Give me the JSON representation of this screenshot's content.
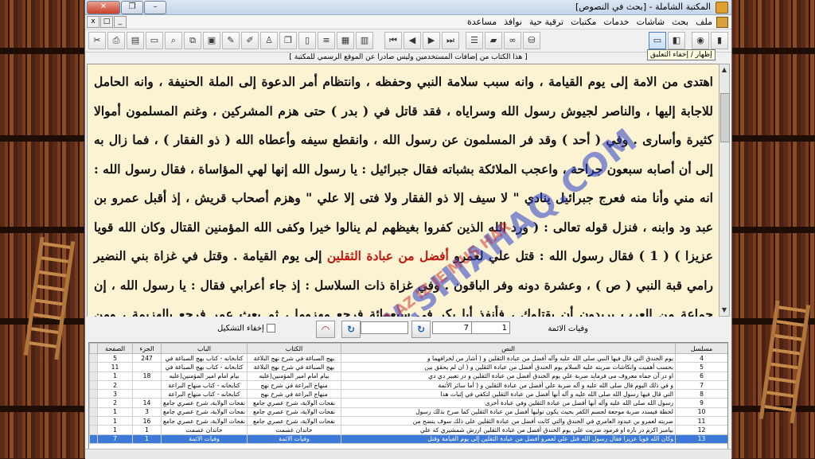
{
  "window": {
    "title": "المكتبة الشاملة - [بحث في النصوص]",
    "buttons": {
      "minimize": "–",
      "restore": "❐",
      "close": "✕"
    }
  },
  "menu": {
    "items": [
      "ملف",
      "بحث",
      "شاشات",
      "خدمات",
      "مكتبات",
      "ترقية حية",
      "نوافذ",
      "مساعدة"
    ],
    "mdi_buttons": {
      "close": "x",
      "restore": "□",
      "minimize": "_"
    }
  },
  "toolbar": {
    "tooltip": "إظهار / إخفاء التعليق"
  },
  "notice": "[ هذا الكتاب من إضافات المستخدمين وليس صادرا عن الموقع الرسمي للمكتبة ]",
  "reader": {
    "before_highlight": "اهتدى من الامة إلى يوم القيامة ، وانه سبب سلامة النبي وحفظه ، وانتظام أمر الدعوة إلى الملة الحنيفة ، وانه الحامل للاجابة إليها ، والناصر لجيوش رسول الله وسراياه ، فقد قاتل في ( بدر ) حتى هزم المشركين ، وغنم المسلمون أموالا كثيرة وأسارى . وفي ( أحد ) وقد فر المسلمون عن رسول الله ، وانقطع سيفه وأعطاه الله ( ذو الفقار ) ، فما زال به إلى أن أصابه سبعون جراحة ، واعجب الملائكة بشباته فقال جبرائيل : يا رسول الله إنها لهي المؤاساة ، فقال رسول الله : انه مني وأنا منه فعرج جبرائيل ينادي \" لا سيف إلا ذو الفقار ولا فتى إلا علي \" وهزم أصحاب قريش ، إذ أقبل عمرو بن عبد ود وابنه ، فنزل قوله تعالى : ( ورد الله الذين كفروا بغيظهم لم ينالوا خيرا وكفى الله المؤمنين القتال وكان الله قويا عزيزا ) ( 1 ) فقال رسول الله : قتل علي لعمرو ",
    "highlight": "أفضل من عبادة الثقلين",
    "after_highlight": " إلى يوم القيامة . وقتل في غزاة بني النضير رامي قبة النبي ( ص ) ، وعشرة دونه وفر الباقون . وفي غزاة ذات السلاسل : إذ جاء أعرابي فقال : يا رسول الله ، إن جماعة من العرب يريدون أن يقتلوك ، فأنفذ أبا بكر في سبعمائة فرجع مهزوما ، ثم بعث عمر فرجع بالهزيمة ، ومن أصحابه مهزومين ، فقال رسول الله : في الثالثة أين"
  },
  "watermark": {
    "main": "WWW.SHIAHAQ.COM",
    "sub": "FAR AZ IZ JE MUS HAR"
  },
  "nav": {
    "label": "وفيات الائمة",
    "field_1": "1",
    "field_2": "7",
    "refresh_glyph": "↻",
    "hide_format_label": "إخفاء التشكيل"
  },
  "grid": {
    "headers": {
      "serial": "مسلسل",
      "text": "النص",
      "book": "الكتاب",
      "chapter": "الباب",
      "part": "الجزء",
      "page": "الصفحة"
    },
    "rows": [
      {
        "serial": "4",
        "text": "يوم الخندق التي قال فيها النبي صلى الله عليه وآله أفضل من عبادة الثقلين و ( أشار من لخرافهما و",
        "book": "بهج الصباغة في شرح نهج البلاغة",
        "chapter": "كتابخانه - كتاب بهج الصباغة في",
        "part": "247",
        "page": "5"
      },
      {
        "serial": "5",
        "text": "بحسب أهميت وانكاشات ضربته عليه السلام يوم الخندق أفضل من عبادة الثقلين و ( ان لم يحقق بين",
        "book": "بهج الصباغة في شرح نهج البلاغة",
        "chapter": "كتابخانه - كتاب بهج الصباغة في",
        "part": "",
        "page": "11"
      },
      {
        "serial": "6",
        "text": "او در آن جماه معروف می فرمايد ضربة علي يوم الخندق أفضل من عبادة الثقلين و در تعبير دي دي",
        "book": "بيام امام امير المؤمنين(عليه",
        "chapter": "بيام امام امير المؤمنين(عليه",
        "part": "18",
        "page": "1"
      },
      {
        "serial": "7",
        "text": "و في ذلك اليوم قال صلى الله عليه و آله ضربة علي أفضل من عبادة الثقلين و ( أما سائر الأئمة",
        "book": "منهاج البراعة في شرح نهج",
        "chapter": "كتابخانه - كتاب منهاج البراعة",
        "part": "",
        "page": "2"
      },
      {
        "serial": "8",
        "text": "التي قال فيها رسول الله صلى الله عليه و آله أنها أفضل من عبادة الثقلين لتكفي في إثبات هذا",
        "book": "منهاج البراعة في شرح نهج",
        "chapter": "كتابخانه - كتاب منهاج البراعة",
        "part": "",
        "page": "3"
      },
      {
        "serial": "9",
        "text": "رسول الله صلى الله عليه وآله أنها أفضل من عبادة الثقلين وفي عبادة أخرى",
        "book": "نفحات الولاية، شرح عصري جامع",
        "chapter": "نفحات الولاية، شرح عصري جامع",
        "part": "14",
        "page": "2"
      },
      {
        "serial": "10",
        "text": "لحظة فيسدد ضربة موجعة لجسم الكفر بحيث يكون توليها أفضل من عبادة الثقلين كما صرح بذلك رسول",
        "book": "نفحات الولاية، شرح عصري جامع",
        "chapter": "نفحات الولاية، شرح عصري جامع",
        "part": "3",
        "page": "1"
      },
      {
        "serial": "11",
        "text": "ضربته لعمرو بن عبدود العامري في الخندق والتي كانت أفضل من عبادة الثقلين على ذلك سوف يتضح من",
        "book": "نفحات الولاية، شرح عصري جامع",
        "chapter": "نفحات الولاية، شرح عصري جامع",
        "part": "16",
        "page": "1"
      },
      {
        "serial": "12",
        "text": "بيامبر اكرم در باره او فرمود ضربت علي يوم الخندق أفضل من عبادة الثقلين ارزش شمشيري كه علي",
        "book": "خاندان عصمت",
        "chapter": "خاندان عصمت",
        "part": "1",
        "page": "1"
      },
      {
        "serial": "13",
        "text": "وكان الله قويا عزيزا فقال رسول الله قتل علي لعمرو أفضل من عبادة الثقلين إلى يوم القيامة وقتل",
        "book": "وفيات الائمة",
        "chapter": "وفيات الائمة",
        "part": "1",
        "page": "7"
      }
    ]
  }
}
